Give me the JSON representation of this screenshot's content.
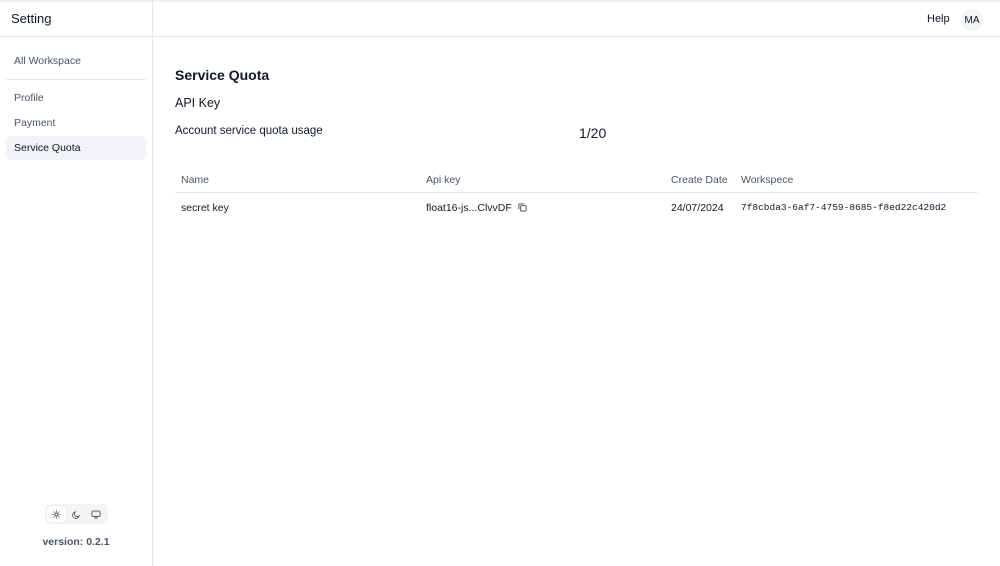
{
  "header": {
    "title": "Setting",
    "help_label": "Help",
    "avatar_initials": "MA"
  },
  "sidebar": {
    "items": [
      {
        "label": "All Workspace"
      },
      {
        "label": "Profile"
      },
      {
        "label": "Payment"
      },
      {
        "label": "Service Quota",
        "active": true
      }
    ],
    "theme_options": [
      "sun-icon",
      "moon-icon",
      "monitor-icon"
    ],
    "version": "version: 0.2.1"
  },
  "main": {
    "title": "Service Quota",
    "subtitle": "API Key",
    "quota_label": "Account service quota usage",
    "quota_value": "1/20",
    "table": {
      "columns": [
        "Name",
        "Api key",
        "Create Date",
        "Workspece"
      ],
      "rows": [
        {
          "name": "secret key",
          "api_key": "float16-js...ClvvDF",
          "create_date": "24/07/2024",
          "workspace": "7f8cbda3-6af7-4759-8685-f8ed22c420d2"
        }
      ]
    }
  },
  "colors": {
    "active_bg": "#f1f3f6",
    "border": "#e5e7eb",
    "muted_text": "#4b5563"
  }
}
